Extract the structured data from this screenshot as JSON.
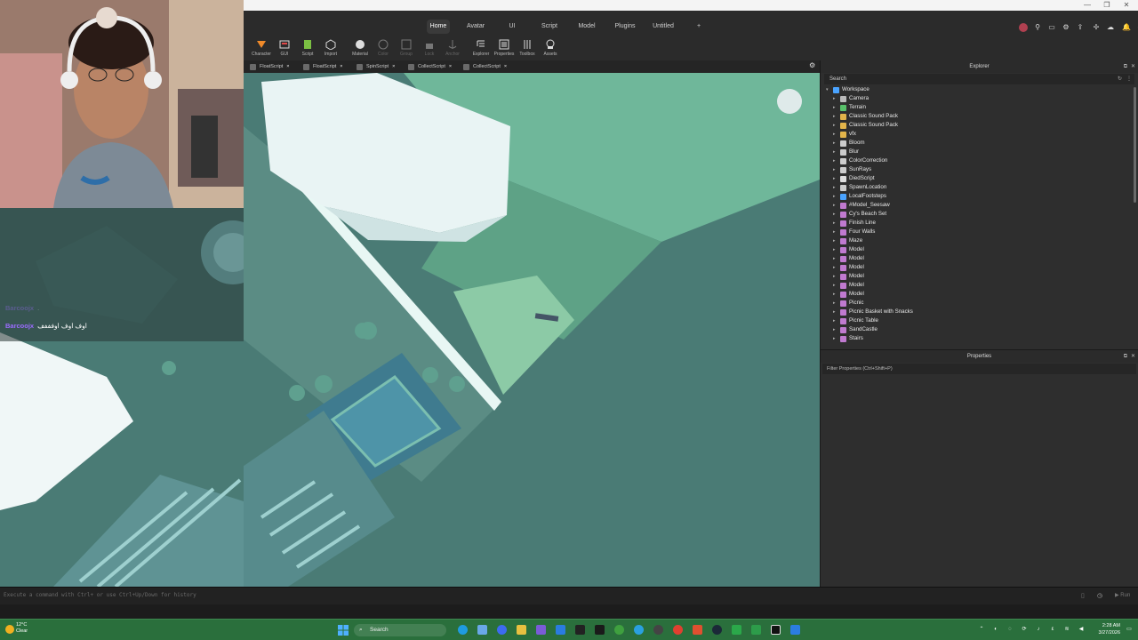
{
  "window": {
    "controls": [
      "—",
      "❐",
      "✕"
    ]
  },
  "menu_tabs": [
    "Home",
    "Avatar",
    "UI",
    "Script",
    "Model",
    "Plugins",
    "Untitled",
    "+"
  ],
  "toolbar": [
    "Character",
    "GUI",
    "Script",
    "Import",
    "Material",
    "Color",
    "Group",
    "Lock",
    "Anchor",
    "Explorer",
    "Properties",
    "Toolbox",
    "Assets"
  ],
  "script_tabs": [
    "FloatScript",
    "FloatScript",
    "SpinScript",
    "CollectScript",
    "CollectScript"
  ],
  "chat": [
    {
      "user": "Barcoojx",
      "message": "."
    },
    {
      "user": "Barcoojx",
      "message": "اوف اوف اوفففف"
    }
  ],
  "explorer": {
    "title": "Explorer",
    "search_placeholder": "Search",
    "items": [
      {
        "name": "Workspace",
        "icon": "workspace-icon",
        "color": "#4aa3ff",
        "level": 0,
        "expanded": true
      },
      {
        "name": "Camera",
        "icon": "camera-icon",
        "color": "#bbbbbb",
        "level": 1,
        "expanded": false
      },
      {
        "name": "Terrain",
        "icon": "terrain-icon",
        "color": "#58c06a",
        "level": 1,
        "expanded": false
      },
      {
        "name": "Classic Sound Pack",
        "icon": "folder-icon",
        "color": "#e2b44a",
        "level": 1,
        "expanded": false
      },
      {
        "name": "Classic Sound Pack",
        "icon": "folder-icon",
        "color": "#e2b44a",
        "level": 1,
        "expanded": false
      },
      {
        "name": "vfx",
        "icon": "folder-icon",
        "color": "#e2b44a",
        "level": 1,
        "expanded": false
      },
      {
        "name": "Bloom",
        "icon": "effect-icon",
        "color": "#cccccc",
        "level": 1,
        "expanded": false
      },
      {
        "name": "Blur",
        "icon": "effect-icon",
        "color": "#cccccc",
        "level": 1,
        "expanded": false
      },
      {
        "name": "ColorCorrection",
        "icon": "effect-icon",
        "color": "#cccccc",
        "level": 1,
        "expanded": false
      },
      {
        "name": "SunRays",
        "icon": "sun-icon",
        "color": "#cccccc",
        "level": 1,
        "expanded": false
      },
      {
        "name": "DiedScript",
        "icon": "script-icon",
        "color": "#dddddd",
        "level": 1,
        "expanded": false
      },
      {
        "name": "SpawnLocation",
        "icon": "spawn-icon",
        "color": "#cccccc",
        "level": 1,
        "expanded": false
      },
      {
        "name": "LocalFootsteps",
        "icon": "script-icon",
        "color": "#4aa3ff",
        "level": 1,
        "expanded": false
      },
      {
        "name": "#Model_Seesaw",
        "icon": "model-icon",
        "color": "#c07ad0",
        "level": 1,
        "expanded": false
      },
      {
        "name": "Cy's Beach Set",
        "icon": "model-icon",
        "color": "#c07ad0",
        "level": 1,
        "expanded": false
      },
      {
        "name": "Finish Line",
        "icon": "model-icon",
        "color": "#c07ad0",
        "level": 1,
        "expanded": false
      },
      {
        "name": "Four Walls",
        "icon": "model-icon",
        "color": "#c07ad0",
        "level": 1,
        "expanded": false
      },
      {
        "name": "Maze",
        "icon": "model-icon",
        "color": "#c07ad0",
        "level": 1,
        "expanded": false
      },
      {
        "name": "Model",
        "icon": "model-icon",
        "color": "#c07ad0",
        "level": 1,
        "expanded": false
      },
      {
        "name": "Model",
        "icon": "model-icon",
        "color": "#c07ad0",
        "level": 1,
        "expanded": false
      },
      {
        "name": "Model",
        "icon": "model-icon",
        "color": "#c07ad0",
        "level": 1,
        "expanded": false
      },
      {
        "name": "Model",
        "icon": "model-icon",
        "color": "#c07ad0",
        "level": 1,
        "expanded": false
      },
      {
        "name": "Model",
        "icon": "model-icon",
        "color": "#c07ad0",
        "level": 1,
        "expanded": false
      },
      {
        "name": "Model",
        "icon": "model-icon",
        "color": "#c07ad0",
        "level": 1,
        "expanded": false
      },
      {
        "name": "Picnic",
        "icon": "model-icon",
        "color": "#c07ad0",
        "level": 1,
        "expanded": false
      },
      {
        "name": "Picnic Basket with Snacks",
        "icon": "model-icon",
        "color": "#c07ad0",
        "level": 1,
        "expanded": false
      },
      {
        "name": "Picnic Table",
        "icon": "model-icon",
        "color": "#c07ad0",
        "level": 1,
        "expanded": false
      },
      {
        "name": "SandCastle",
        "icon": "model-icon",
        "color": "#c07ad0",
        "level": 1,
        "expanded": false
      },
      {
        "name": "Stairs",
        "icon": "model-icon",
        "color": "#c07ad0",
        "level": 1,
        "expanded": false
      }
    ]
  },
  "properties": {
    "title": "Properties",
    "filter_placeholder": "Filter Properties (Ctrl+Shift+P)"
  },
  "command_bar": {
    "placeholder": "Execute a command with Ctrl+ or use Ctrl+Up/Down for history"
  },
  "taskbar": {
    "weather_temp": "12°C",
    "weather_desc": "Clear",
    "search_label": "Search",
    "time": "2:28 AM",
    "date": "3/27/2026"
  },
  "colors": {
    "taskbar": "#2a6f3c",
    "accent": "#4aa3ff",
    "studio_bg": "#2e2e2e"
  }
}
